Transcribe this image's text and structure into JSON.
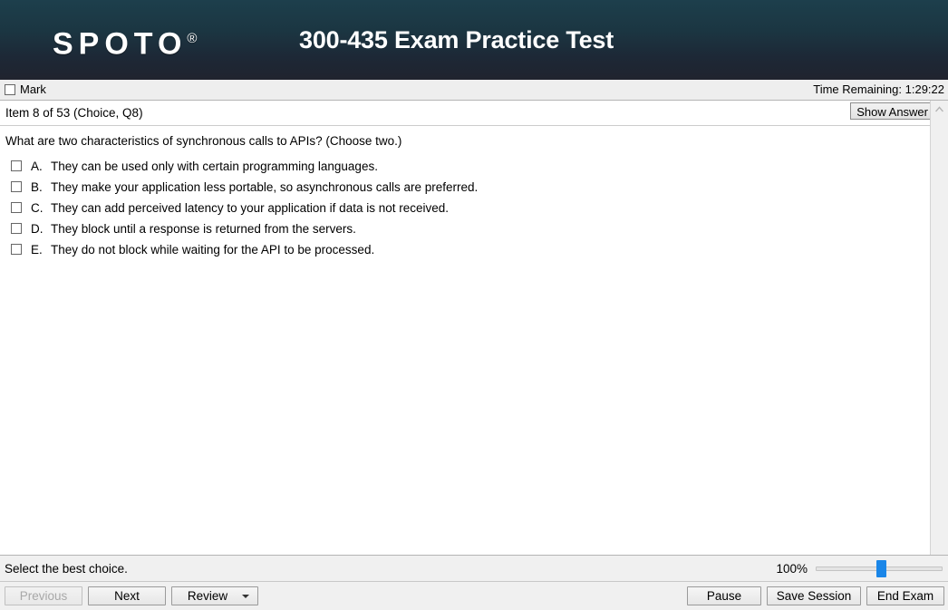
{
  "header": {
    "logo_text": "SPOTO",
    "logo_registered": "®",
    "title": "300-435 Exam Practice Test"
  },
  "markbar": {
    "mark_label": "Mark",
    "timer_text": "Time Remaining: 1:29:22"
  },
  "item": {
    "label": "Item 8 of 53  (Choice, Q8)",
    "show_answer_label": "Show Answer"
  },
  "question": {
    "text": "What are two characteristics of synchronous calls to APIs? (Choose two.)",
    "choices": [
      {
        "letter": "A.",
        "text": "They can be used only with certain programming languages.",
        "checked": false
      },
      {
        "letter": "B.",
        "text": "They make your application less portable, so asynchronous calls are preferred.",
        "checked": false
      },
      {
        "letter": "C.",
        "text": "They can add perceived latency to your application if data is not received.",
        "checked": false
      },
      {
        "letter": "D.",
        "text": "They block until a response is returned from the servers.",
        "checked": false
      },
      {
        "letter": "E.",
        "text": "They do not block while waiting for the API to be processed.",
        "checked": false
      }
    ]
  },
  "status": {
    "hint_text": "Select the best choice.",
    "zoom_label": "100%"
  },
  "buttons": {
    "previous": "Previous",
    "next": "Next",
    "review": "Review",
    "pause": "Pause",
    "save_session": "Save Session",
    "end_exam": "End Exam"
  },
  "colors": {
    "header_top": "#1d3f4c",
    "header_bottom": "#20232e",
    "slider_thumb": "#1a86e8",
    "panel_bg": "#ffffff",
    "chrome_bg": "#f0f0f0"
  }
}
